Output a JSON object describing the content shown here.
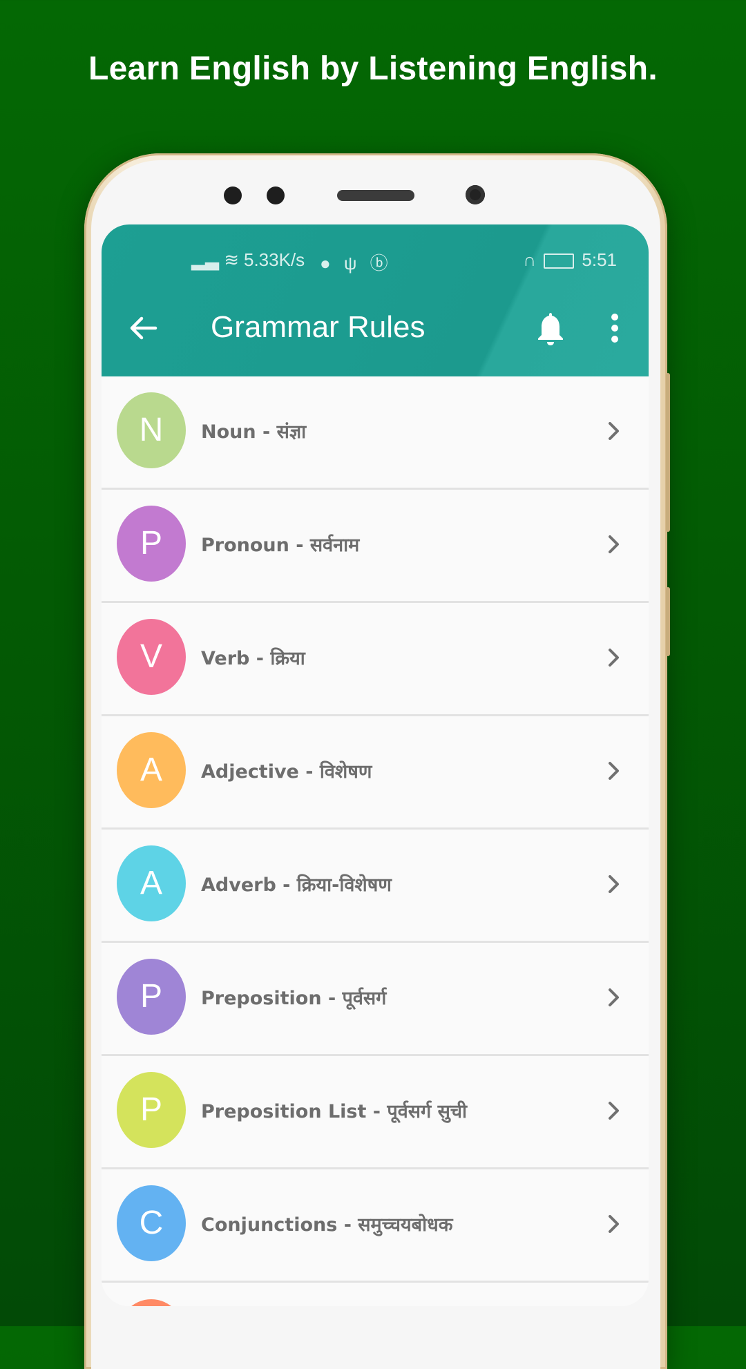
{
  "promo": {
    "headline": "Learn English by Listening English."
  },
  "status_bar": {
    "speed": "5.33K/s",
    "time": "5:51"
  },
  "app_bar": {
    "title": "Grammar Rules",
    "back_icon": "back-arrow-icon",
    "bell_icon": "bell-icon",
    "more_icon": "more-vert-icon"
  },
  "items": [
    {
      "letter": "N",
      "label": "Noun - संज्ञा",
      "color": "#b9d98e"
    },
    {
      "letter": "P",
      "label": "Pronoun - सर्वनाम",
      "color": "#c27ad0"
    },
    {
      "letter": "V",
      "label": "Verb - क्रिया",
      "color": "#f2749a"
    },
    {
      "letter": "A",
      "label": "Adjective - विशेषण",
      "color": "#ffbb5c"
    },
    {
      "letter": "A",
      "label": "Adverb - क्रिया-विशेषण",
      "color": "#5ed3e6"
    },
    {
      "letter": "P",
      "label": "Preposition - पूर्वसर्ग",
      "color": "#9f85d6"
    },
    {
      "letter": "P",
      "label": "Preposition List - पूर्वसर्ग सुची",
      "color": "#d4e35c"
    },
    {
      "letter": "C",
      "label": "Conjunctions - समुच्चयबोधक",
      "color": "#63b2f2"
    }
  ],
  "partial_item": {
    "color": "#ff8a65"
  }
}
